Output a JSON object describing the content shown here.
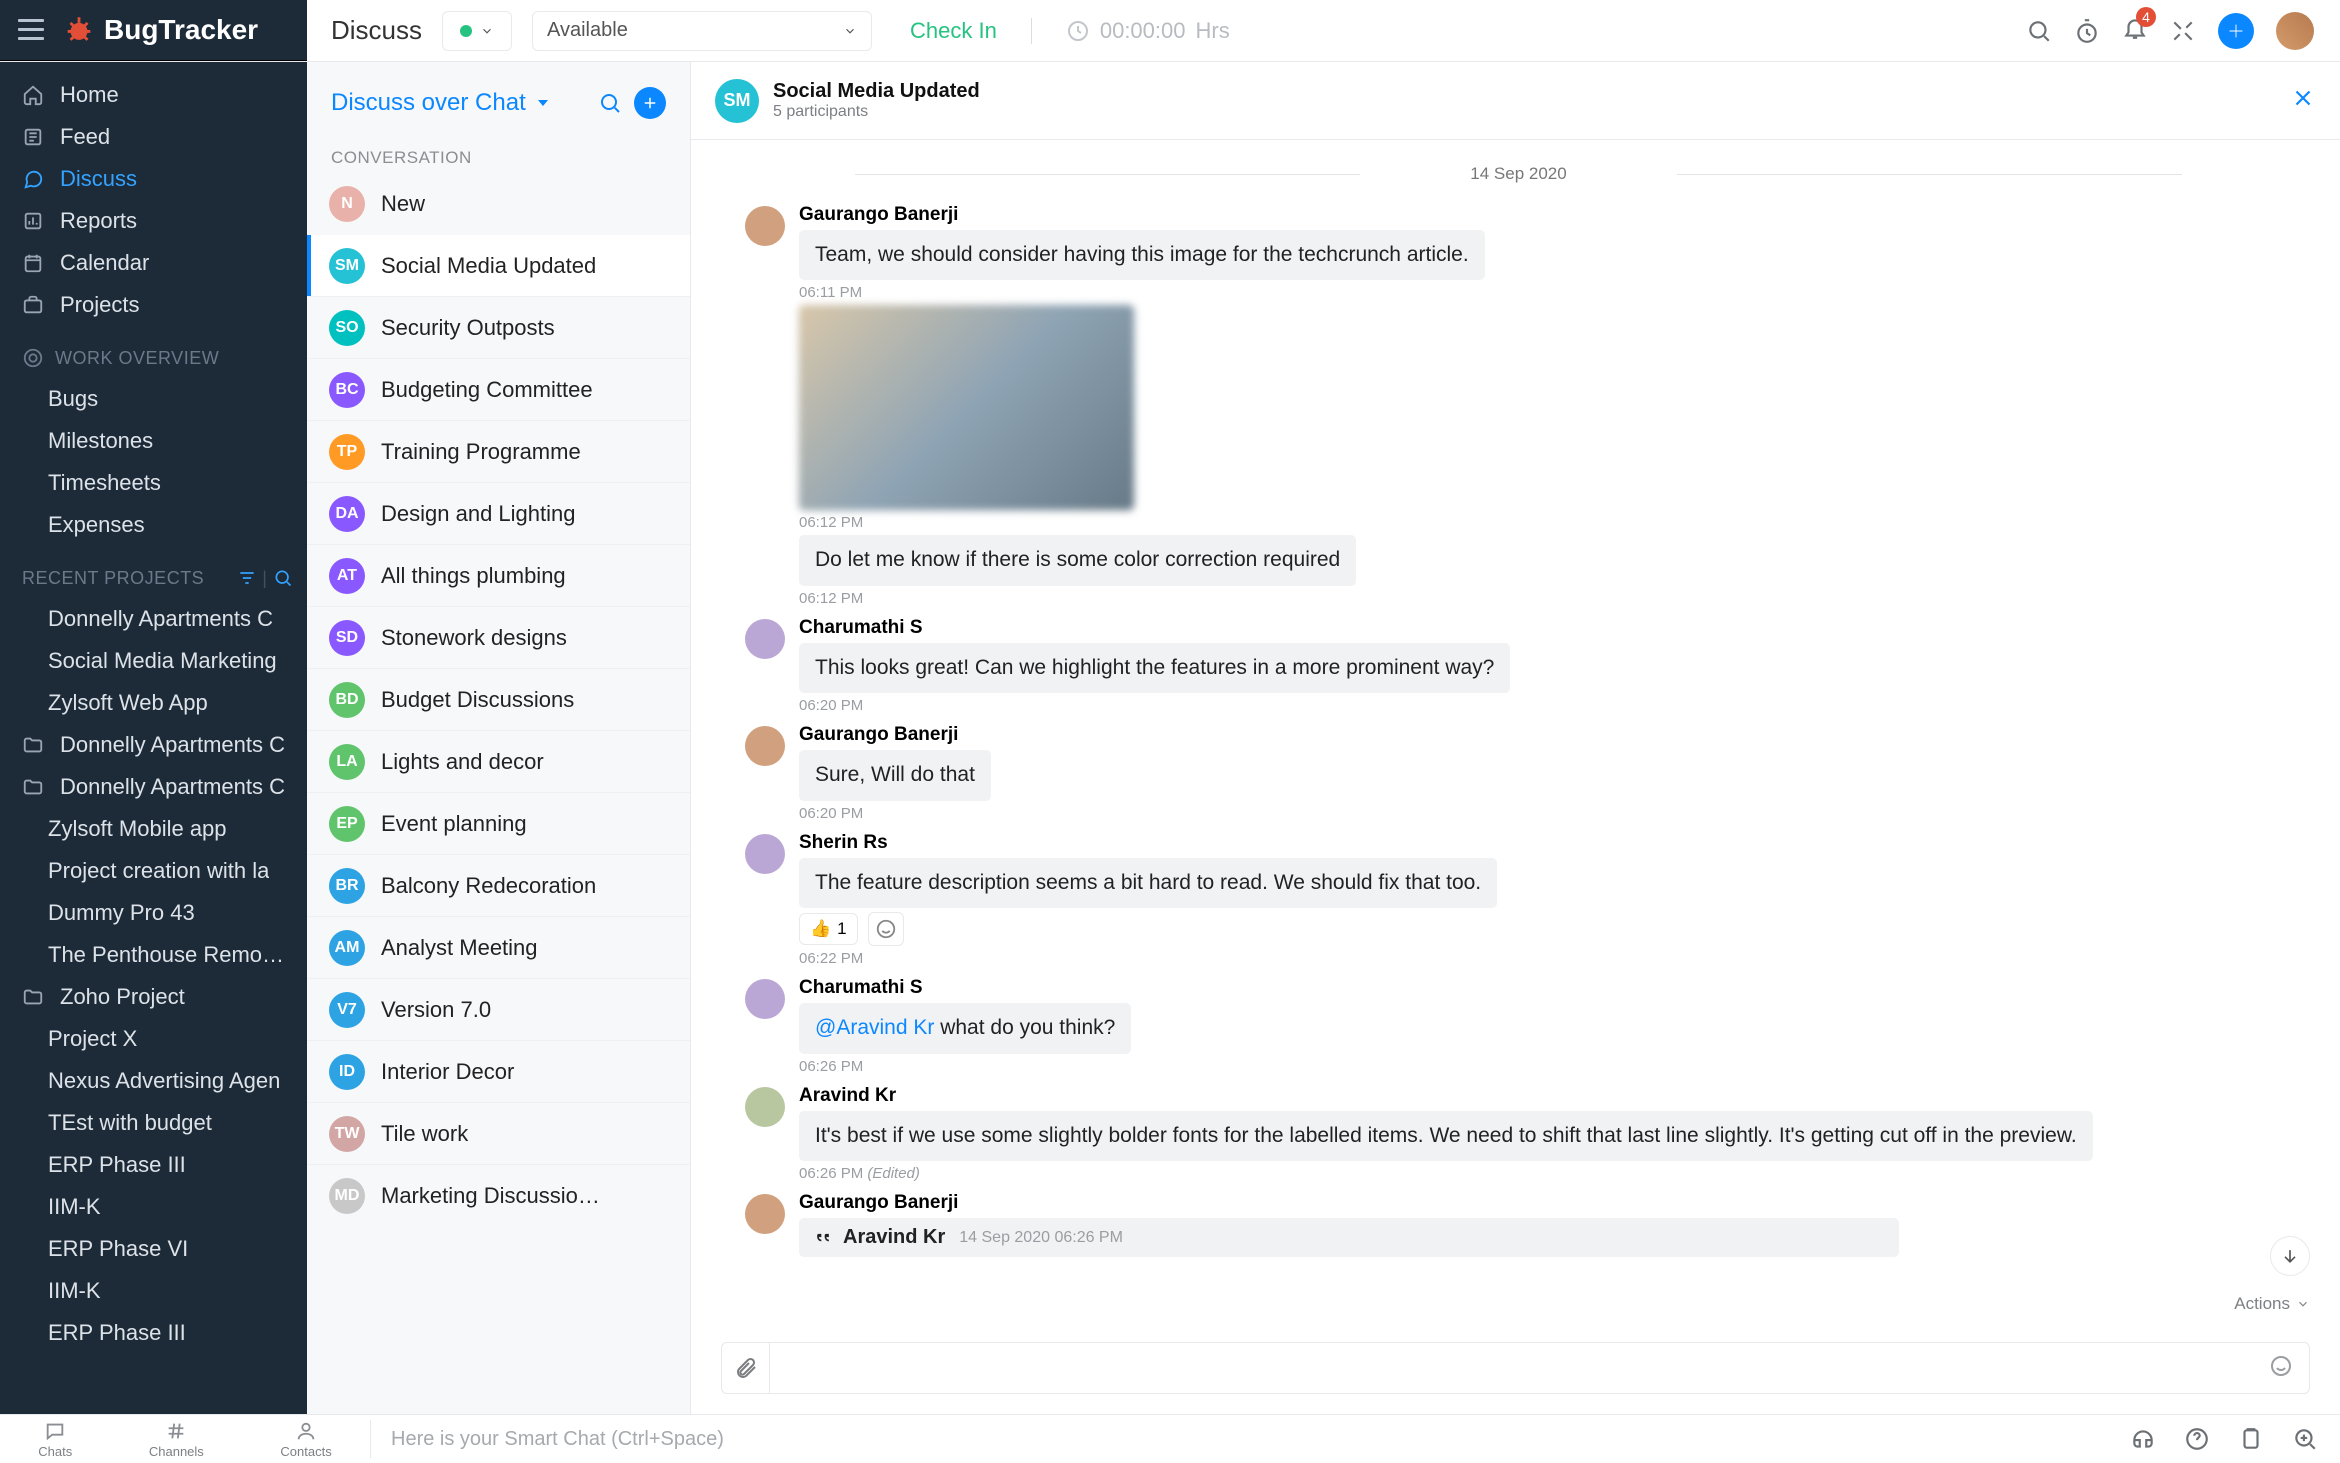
{
  "brand": {
    "name": "BugTracker"
  },
  "topbar": {
    "title": "Discuss",
    "availability": "Available",
    "check_in": "Check In",
    "timer": "00:00:00",
    "timer_unit": "Hrs",
    "notification_count": "4"
  },
  "sidebar": {
    "main": [
      {
        "icon": "home",
        "label": "Home"
      },
      {
        "icon": "feed",
        "label": "Feed"
      },
      {
        "icon": "chat",
        "label": "Discuss",
        "active": true
      },
      {
        "icon": "report",
        "label": "Reports"
      },
      {
        "icon": "calendar",
        "label": "Calendar"
      },
      {
        "icon": "projects",
        "label": "Projects"
      }
    ],
    "overview_header": "WORK OVERVIEW",
    "overview": [
      {
        "label": "Bugs"
      },
      {
        "label": "Milestones"
      },
      {
        "label": "Timesheets"
      },
      {
        "label": "Expenses"
      }
    ],
    "recent_header": "RECENT PROJECTS",
    "recent": [
      {
        "label": "Donnelly Apartments C",
        "icon": false
      },
      {
        "label": "Social Media Marketing",
        "icon": false
      },
      {
        "label": "Zylsoft Web App",
        "icon": false
      },
      {
        "label": "Donnelly Apartments C",
        "icon": true
      },
      {
        "label": "Donnelly Apartments C",
        "icon": true
      },
      {
        "label": "Zylsoft Mobile app",
        "icon": false
      },
      {
        "label": "Project creation with la",
        "icon": false
      },
      {
        "label": "Dummy Pro 43",
        "icon": false
      },
      {
        "label": "The Penthouse Remode",
        "icon": false
      },
      {
        "label": "Zoho Project",
        "icon": true
      },
      {
        "label": "Project X",
        "icon": false
      },
      {
        "label": "Nexus Advertising Agen",
        "icon": false
      },
      {
        "label": "TEst with budget",
        "icon": false
      },
      {
        "label": "ERP Phase III",
        "icon": false
      },
      {
        "label": "IIM-K",
        "icon": false
      },
      {
        "label": "ERP Phase VI",
        "icon": false
      },
      {
        "label": "IIM-K",
        "icon": false
      },
      {
        "label": "ERP Phase III",
        "icon": false
      }
    ]
  },
  "convpane": {
    "switcher": "Discuss over Chat",
    "section": "CONVERSATION",
    "items": [
      {
        "initials": "N",
        "color": "#e8b1a9",
        "label": "New"
      },
      {
        "initials": "SM",
        "color": "#25c1d4",
        "label": "Social Media Updated",
        "selected": true
      },
      {
        "initials": "SO",
        "color": "#00c0c0",
        "label": "Security Outposts"
      },
      {
        "initials": "BC",
        "color": "#8a58ff",
        "label": "Budgeting Committee"
      },
      {
        "initials": "TP",
        "color": "#ff9a24",
        "label": "Training Programme"
      },
      {
        "initials": "DA",
        "color": "#8a58ff",
        "label": "Design and Lighting"
      },
      {
        "initials": "AT",
        "color": "#8a58ff",
        "label": "All things plumbing"
      },
      {
        "initials": "SD",
        "color": "#8a58ff",
        "label": "Stonework designs"
      },
      {
        "initials": "BD",
        "color": "#5fc46b",
        "label": "Budget Discussions"
      },
      {
        "initials": "LA",
        "color": "#5fc46b",
        "label": "Lights and decor"
      },
      {
        "initials": "EP",
        "color": "#5fc46b",
        "label": "Event planning"
      },
      {
        "initials": "BR",
        "color": "#2da3e3",
        "label": "Balcony Redecoration"
      },
      {
        "initials": "AM",
        "color": "#2da3e3",
        "label": "Analyst Meeting"
      },
      {
        "initials": "V7",
        "color": "#2da3e3",
        "label": "Version 7.0"
      },
      {
        "initials": "ID",
        "color": "#2da3e3",
        "label": "Interior Decor"
      },
      {
        "initials": "TW",
        "color": "#d3a6a6",
        "label": "Tile work"
      },
      {
        "initials": "MD",
        "color": "#c8c8c8",
        "label": "Marketing Discussio…"
      }
    ]
  },
  "chat_header": {
    "initials": "SM",
    "color": "#25c1d4",
    "title": "Social Media Updated",
    "subtitle": "5 participants"
  },
  "date": "14 Sep 2020",
  "messages": [
    {
      "who": "Gaurango Banerji",
      "ava": "alt1",
      "bubbles": [
        {
          "text": "Team, we should consider having this image for the techcrunch article.",
          "time": "06:11 PM"
        },
        {
          "image": true,
          "time": "06:12 PM"
        },
        {
          "text": "Do let me know if there is some color correction required",
          "time": "06:12 PM"
        }
      ]
    },
    {
      "who": "Charumathi S",
      "ava": "alt2",
      "bubbles": [
        {
          "text": "This looks great! Can we highlight the features in a more prominent way?",
          "time": "06:20 PM"
        }
      ]
    },
    {
      "who": "Gaurango Banerji",
      "ava": "alt1",
      "bubbles": [
        {
          "text": "Sure, Will do that",
          "time": "06:20 PM"
        }
      ]
    },
    {
      "who": "Sherin Rs",
      "ava": "alt2",
      "bubbles": [
        {
          "text": "The feature description seems a bit hard to read. We should fix that too.",
          "reaction": {
            "emoji": "👍",
            "count": "1"
          },
          "time": "06:22 PM"
        }
      ]
    },
    {
      "who": "Charumathi S",
      "ava": "alt2",
      "bubbles": [
        {
          "mention": "@Aravind Kr",
          "text": " what do you think?",
          "time": "06:26 PM"
        }
      ]
    },
    {
      "who": "Aravind Kr",
      "ava": "alt3",
      "bubbles": [
        {
          "text": "It's best if we use some slightly bolder fonts for the labelled items. We need to shift that last line slightly. It's getting cut off in the preview.",
          "time": "06:26 PM",
          "edited": "(Edited)"
        }
      ]
    },
    {
      "who": "Gaurango Banerji",
      "ava": "alt1",
      "bubbles": [
        {
          "reply": {
            "to": "Aravind Kr",
            "date": "14 Sep 2020 06:26 PM"
          }
        }
      ]
    }
  ],
  "actions_label": "Actions",
  "bottom": {
    "tabs": [
      "Chats",
      "Channels",
      "Contacts"
    ],
    "smart": "Here is your Smart Chat (Ctrl+Space)"
  }
}
